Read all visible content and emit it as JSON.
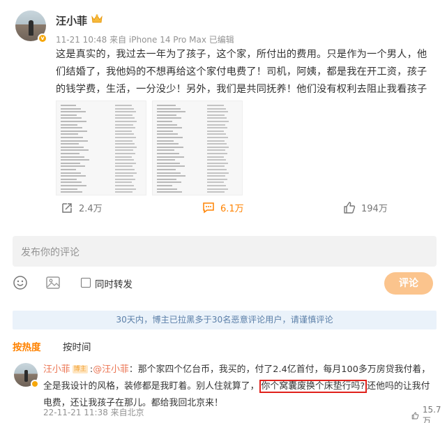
{
  "post": {
    "author": "汪小菲",
    "meta": "11-21 10:48 来自 iPhone 14 Pro Max 已编辑",
    "text": "这是真实的，我过去一年为了孩子，这个家，所付出的费用。只是作为一个男人，他们结婚了，我他妈的不想再给这个家付电费了！司机，阿姨，都是我在开工资，孩子的钱学费，生活，一分没少！另外，我们是共同抚养！他们没有权利去阻止我看孩子",
    "images": [
      "expense-list-image-1",
      "expense-list-image-2"
    ]
  },
  "actions": {
    "share_count": "2.4万",
    "comment_count": "6.1万",
    "like_count": "194万"
  },
  "comment_input": {
    "placeholder": "发布你的评论",
    "forward_label": "同时转发",
    "submit_label": "评论"
  },
  "notice": "30天内，博主已拉黑多于30名恶意评论用户，请谨慎评论",
  "sort_tabs": [
    "按热度",
    "按时间"
  ],
  "reply": {
    "author": "汪小菲",
    "badge": "博主",
    "mention": "@汪小菲",
    "text_before": "：那个家四个亿台币，我买的，付了2.4亿首付，每月100多万房贷我付着，全是我设计的风格，装修都是我盯着。别人住就算了，",
    "text_highlight": "你个窝囊废换个床垫行吗?",
    "text_after": "还他吗的让我付电费，还让我孩子在那儿。都给我回北京来！",
    "meta": "22-11-21 11:38 来自北京",
    "like_count": "15.7万"
  },
  "colors": {
    "accent": "#ff8200",
    "link": "#eb7350",
    "notice_bg": "#eaf2fa",
    "notice_text": "#5b7fa8",
    "highlight_border": "#e0211b"
  },
  "icons": [
    "crown-icon",
    "share-icon",
    "comment-icon",
    "like-icon",
    "emoji-icon",
    "image-icon"
  ]
}
